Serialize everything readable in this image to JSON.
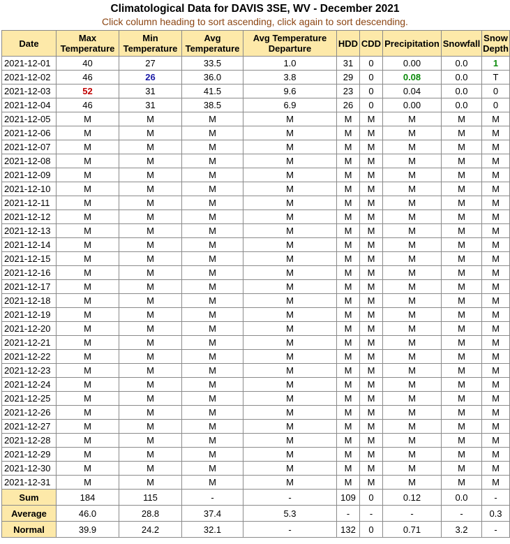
{
  "title": "Climatological Data for DAVIS 3SE, WV - December 2021",
  "subtitle": "Click column heading to sort ascending, click again to sort descending.",
  "headers": [
    {
      "l1": "Date",
      "l2": ""
    },
    {
      "l1": "Max",
      "l2": "Temperature"
    },
    {
      "l1": "Min",
      "l2": "Temperature"
    },
    {
      "l1": "Avg",
      "l2": "Temperature"
    },
    {
      "l1": "Avg Temperature",
      "l2": "Departure"
    },
    {
      "l1": "HDD",
      "l2": ""
    },
    {
      "l1": "CDD",
      "l2": ""
    },
    {
      "l1": "Precipitation",
      "l2": ""
    },
    {
      "l1": "Snowfall",
      "l2": ""
    },
    {
      "l1": "Snow",
      "l2": "Depth"
    }
  ],
  "rows": [
    [
      "2021-12-01",
      "40",
      "27",
      "33.5",
      "1.0",
      "31",
      "0",
      "0.00",
      "0.0",
      "1"
    ],
    [
      "2021-12-02",
      "46",
      "26",
      "36.0",
      "3.8",
      "29",
      "0",
      "0.08",
      "0.0",
      "T"
    ],
    [
      "2021-12-03",
      "52",
      "31",
      "41.5",
      "9.6",
      "23",
      "0",
      "0.04",
      "0.0",
      "0"
    ],
    [
      "2021-12-04",
      "46",
      "31",
      "38.5",
      "6.9",
      "26",
      "0",
      "0.00",
      "0.0",
      "0"
    ],
    [
      "2021-12-05",
      "M",
      "M",
      "M",
      "M",
      "M",
      "M",
      "M",
      "M",
      "M"
    ],
    [
      "2021-12-06",
      "M",
      "M",
      "M",
      "M",
      "M",
      "M",
      "M",
      "M",
      "M"
    ],
    [
      "2021-12-07",
      "M",
      "M",
      "M",
      "M",
      "M",
      "M",
      "M",
      "M",
      "M"
    ],
    [
      "2021-12-08",
      "M",
      "M",
      "M",
      "M",
      "M",
      "M",
      "M",
      "M",
      "M"
    ],
    [
      "2021-12-09",
      "M",
      "M",
      "M",
      "M",
      "M",
      "M",
      "M",
      "M",
      "M"
    ],
    [
      "2021-12-10",
      "M",
      "M",
      "M",
      "M",
      "M",
      "M",
      "M",
      "M",
      "M"
    ],
    [
      "2021-12-11",
      "M",
      "M",
      "M",
      "M",
      "M",
      "M",
      "M",
      "M",
      "M"
    ],
    [
      "2021-12-12",
      "M",
      "M",
      "M",
      "M",
      "M",
      "M",
      "M",
      "M",
      "M"
    ],
    [
      "2021-12-13",
      "M",
      "M",
      "M",
      "M",
      "M",
      "M",
      "M",
      "M",
      "M"
    ],
    [
      "2021-12-14",
      "M",
      "M",
      "M",
      "M",
      "M",
      "M",
      "M",
      "M",
      "M"
    ],
    [
      "2021-12-15",
      "M",
      "M",
      "M",
      "M",
      "M",
      "M",
      "M",
      "M",
      "M"
    ],
    [
      "2021-12-16",
      "M",
      "M",
      "M",
      "M",
      "M",
      "M",
      "M",
      "M",
      "M"
    ],
    [
      "2021-12-17",
      "M",
      "M",
      "M",
      "M",
      "M",
      "M",
      "M",
      "M",
      "M"
    ],
    [
      "2021-12-18",
      "M",
      "M",
      "M",
      "M",
      "M",
      "M",
      "M",
      "M",
      "M"
    ],
    [
      "2021-12-19",
      "M",
      "M",
      "M",
      "M",
      "M",
      "M",
      "M",
      "M",
      "M"
    ],
    [
      "2021-12-20",
      "M",
      "M",
      "M",
      "M",
      "M",
      "M",
      "M",
      "M",
      "M"
    ],
    [
      "2021-12-21",
      "M",
      "M",
      "M",
      "M",
      "M",
      "M",
      "M",
      "M",
      "M"
    ],
    [
      "2021-12-22",
      "M",
      "M",
      "M",
      "M",
      "M",
      "M",
      "M",
      "M",
      "M"
    ],
    [
      "2021-12-23",
      "M",
      "M",
      "M",
      "M",
      "M",
      "M",
      "M",
      "M",
      "M"
    ],
    [
      "2021-12-24",
      "M",
      "M",
      "M",
      "M",
      "M",
      "M",
      "M",
      "M",
      "M"
    ],
    [
      "2021-12-25",
      "M",
      "M",
      "M",
      "M",
      "M",
      "M",
      "M",
      "M",
      "M"
    ],
    [
      "2021-12-26",
      "M",
      "M",
      "M",
      "M",
      "M",
      "M",
      "M",
      "M",
      "M"
    ],
    [
      "2021-12-27",
      "M",
      "M",
      "M",
      "M",
      "M",
      "M",
      "M",
      "M",
      "M"
    ],
    [
      "2021-12-28",
      "M",
      "M",
      "M",
      "M",
      "M",
      "M",
      "M",
      "M",
      "M"
    ],
    [
      "2021-12-29",
      "M",
      "M",
      "M",
      "M",
      "M",
      "M",
      "M",
      "M",
      "M"
    ],
    [
      "2021-12-30",
      "M",
      "M",
      "M",
      "M",
      "M",
      "M",
      "M",
      "M",
      "M"
    ],
    [
      "2021-12-31",
      "M",
      "M",
      "M",
      "M",
      "M",
      "M",
      "M",
      "M",
      "M"
    ]
  ],
  "highlights": [
    {
      "row": 2,
      "col": 1,
      "color": "red"
    },
    {
      "row": 1,
      "col": 2,
      "color": "blue"
    },
    {
      "row": 1,
      "col": 7,
      "color": "green"
    },
    {
      "row": 0,
      "col": 9,
      "color": "green"
    }
  ],
  "colors": {
    "red": "#c00000",
    "blue": "#1a1aa6",
    "green": "#0a8a0a",
    "header_bg": "#fde9a9",
    "subtitle": "#8b4513"
  },
  "summary": [
    {
      "label": "Sum",
      "values": [
        "184",
        "115",
        "-",
        "-",
        "109",
        "0",
        "0.12",
        "0.0",
        "-"
      ]
    },
    {
      "label": "Average",
      "values": [
        "46.0",
        "28.8",
        "37.4",
        "5.3",
        "-",
        "-",
        "-",
        "-",
        "0.3"
      ]
    },
    {
      "label": "Normal",
      "values": [
        "39.9",
        "24.2",
        "32.1",
        "-",
        "132",
        "0",
        "0.71",
        "3.2",
        "-"
      ]
    }
  ]
}
